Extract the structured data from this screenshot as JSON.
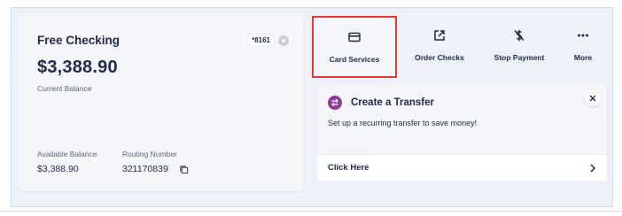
{
  "account": {
    "name": "Free Checking",
    "mask": "*8161",
    "current_balance": "$3,388.90",
    "current_balance_label": "Current Balance",
    "available_balance_label": "Available Balance",
    "available_balance": "$3,388.90",
    "routing_number_label": "Routing Number",
    "routing_number": "321170839",
    "icons": [
      "eye-icon",
      "copy-icon"
    ]
  },
  "actions": [
    {
      "label": "Card Services",
      "icon": "credit-card-icon",
      "selected": true
    },
    {
      "label": "Order Checks",
      "icon": "external-link-icon",
      "selected": false
    },
    {
      "label": "Stop Payment",
      "icon": "dollar-slash-icon",
      "selected": false
    },
    {
      "label": "More",
      "icon": "more-dots-icon",
      "selected": false
    }
  ],
  "transfer_panel": {
    "title": "Create a Transfer",
    "description": "Set up a recurring transfer to save money!",
    "link_label": "Click Here",
    "icons": [
      "transfer-icon",
      "close-icon",
      "chevron-right-icon"
    ]
  },
  "colors": {
    "background": "#eef1f7",
    "card": "#f4f6fa",
    "text": "#1f2a44",
    "highlight_border": "#e53935",
    "transfer_badge": "#8e3a9c"
  }
}
